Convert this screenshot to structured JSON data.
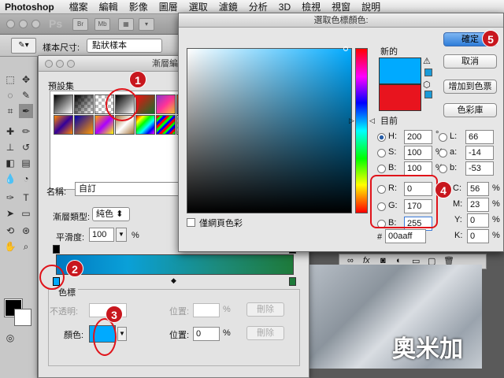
{
  "menubar": {
    "app_name": "Photoshop",
    "items": [
      "檔案",
      "編輯",
      "影像",
      "圖層",
      "選取",
      "濾鏡",
      "分析",
      "3D",
      "檢視",
      "視窗",
      "說明"
    ]
  },
  "appbar": {
    "logo": "Ps",
    "btn1": "Br",
    "btn2": "Mb"
  },
  "options_bar": {
    "sample_size_label": "樣本尺寸:",
    "sample_size_value": "點狀樣本"
  },
  "gradient_editor": {
    "title": "漸層編輯器",
    "presets_label": "預設集",
    "name_label": "名稱:",
    "name_value": "自訂",
    "gradient_type_label": "漸層類型:",
    "gradient_type_value": "純色",
    "smoothness_label": "平滑度:",
    "smoothness_value": "100",
    "smoothness_unit": "%",
    "stops_label": "色標",
    "opacity_label": "不透明:",
    "location_label": "位置:",
    "percent": "%",
    "delete_label": "刪除",
    "color_label": "顏色:",
    "location_value": "0"
  },
  "color_picker": {
    "title": "選取色標顏色:",
    "ok": "確定",
    "cancel": "取消",
    "add_to_swatches": "增加到色票",
    "color_libraries": "色彩庫",
    "new_label": "新的",
    "current_label": "目前",
    "web_only_label": "僅網頁色彩",
    "new_color": "#00aaff",
    "current_color": "#e8141e",
    "hsb": [
      {
        "label": "H:",
        "value": "200",
        "unit": "°"
      },
      {
        "label": "S:",
        "value": "100",
        "unit": "%"
      },
      {
        "label": "B:",
        "value": "100",
        "unit": "%"
      }
    ],
    "rgb": [
      {
        "label": "R:",
        "value": "0"
      },
      {
        "label": "G:",
        "value": "170"
      },
      {
        "label": "B:",
        "value": "255"
      }
    ],
    "lab": [
      {
        "label": "L:",
        "value": "66"
      },
      {
        "label": "a:",
        "value": "-14"
      },
      {
        "label": "b:",
        "value": "-53"
      }
    ],
    "cmyk": [
      {
        "label": "C:",
        "value": "56",
        "unit": "%"
      },
      {
        "label": "M:",
        "value": "23",
        "unit": "%"
      },
      {
        "label": "Y:",
        "value": "0",
        "unit": "%"
      },
      {
        "label": "K:",
        "value": "0",
        "unit": "%"
      }
    ],
    "hex_label": "#",
    "hex_value": "00aaff"
  },
  "callouts": [
    "1",
    "2",
    "3",
    "4",
    "5"
  ],
  "watermark": "奧米加"
}
